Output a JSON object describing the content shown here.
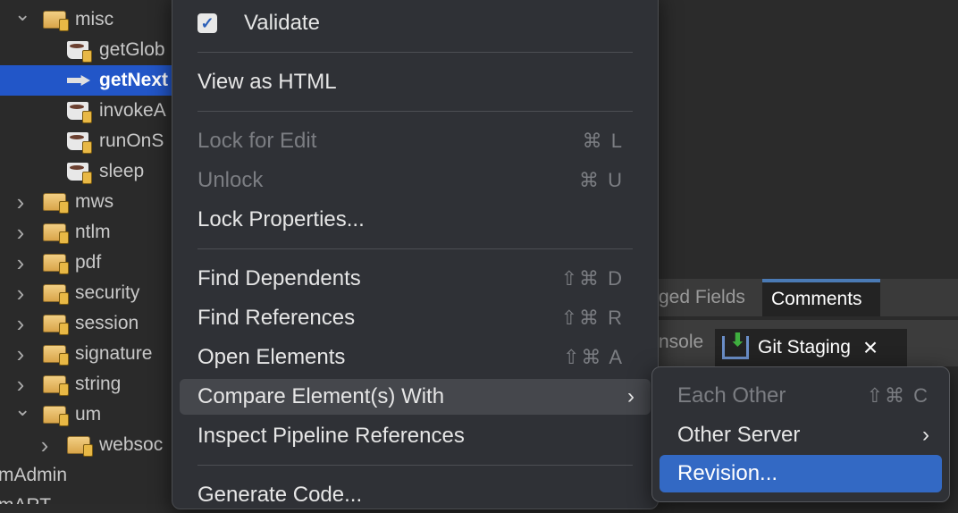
{
  "tree": {
    "items": [
      {
        "label": "misc",
        "type": "folder",
        "expanded": true,
        "level": 1
      },
      {
        "label": "getGlob",
        "type": "service",
        "level": 2
      },
      {
        "label": "getNext",
        "type": "flow",
        "level": 2,
        "selected": true
      },
      {
        "label": "invokeA",
        "type": "service",
        "level": 2
      },
      {
        "label": "runOnS",
        "type": "service",
        "level": 2
      },
      {
        "label": "sleep",
        "type": "service",
        "level": 2
      },
      {
        "label": "mws",
        "type": "folder",
        "level": 1
      },
      {
        "label": "ntlm",
        "type": "folder",
        "level": 1
      },
      {
        "label": "pdf",
        "type": "folder",
        "level": 1
      },
      {
        "label": "security",
        "type": "folder",
        "level": 1
      },
      {
        "label": "session",
        "type": "folder",
        "level": 1
      },
      {
        "label": "signature",
        "type": "folder",
        "level": 1
      },
      {
        "label": "string",
        "type": "folder",
        "level": 1
      },
      {
        "label": "um",
        "type": "folder",
        "expanded": true,
        "level": 1
      },
      {
        "label": "websoc",
        "type": "folder",
        "level": 2
      },
      {
        "label": "mAdmin",
        "type": "package",
        "level": 0
      },
      {
        "label": "mART",
        "type": "package",
        "level": 0
      }
    ]
  },
  "tabs": {
    "top": [
      {
        "label": "ged Fields"
      },
      {
        "label": "Comments",
        "active": true
      }
    ],
    "bottom": [
      {
        "label": "nsole"
      },
      {
        "label": "Git Staging",
        "active": true,
        "close": "×"
      }
    ]
  },
  "context_menu": {
    "validate": {
      "label": "Validate",
      "checked": true,
      "check": "✓"
    },
    "view_html": "View as HTML",
    "lock_edit": {
      "label": "Lock for Edit",
      "shortcut": "⌘ L"
    },
    "unlock": {
      "label": "Unlock",
      "shortcut": "⌘ U"
    },
    "lock_props": "Lock Properties...",
    "find_dependents": {
      "label": "Find Dependents",
      "shortcut": "⇧⌘ D"
    },
    "find_references": {
      "label": "Find References",
      "shortcut": "⇧⌘ R"
    },
    "open_elements": {
      "label": "Open Elements",
      "shortcut": "⇧⌘ A"
    },
    "compare": {
      "label": "Compare Element(s) With",
      "arrow": "›"
    },
    "inspect": "Inspect Pipeline References",
    "generate": "Generate Code..."
  },
  "submenu": {
    "each_other": {
      "label": "Each Other",
      "shortcut": "⇧⌘ C"
    },
    "other_server": {
      "label": "Other Server",
      "arrow": "›"
    },
    "revision": "Revision..."
  },
  "colors": {
    "selection": "#2256c8",
    "menu_bg": "#2f3136",
    "highlight": "#3369c4"
  }
}
